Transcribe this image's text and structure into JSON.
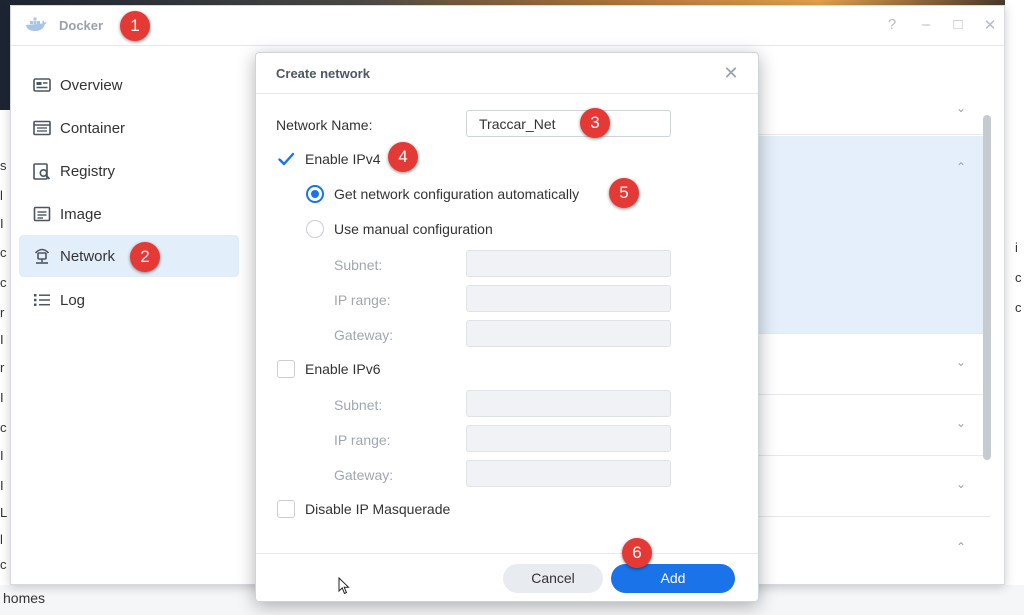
{
  "window": {
    "title": "Docker",
    "controls": {
      "help": "?",
      "minimize": "–",
      "maximize": "□",
      "close": "✕"
    }
  },
  "sidebar": {
    "items": [
      {
        "label": "Overview",
        "icon": "overview-icon"
      },
      {
        "label": "Container",
        "icon": "container-icon"
      },
      {
        "label": "Registry",
        "icon": "registry-icon"
      },
      {
        "label": "Image",
        "icon": "image-icon"
      },
      {
        "label": "Network",
        "icon": "network-icon",
        "active": true
      },
      {
        "label": "Log",
        "icon": "log-icon"
      }
    ]
  },
  "dialog": {
    "title": "Create network",
    "close": "✕",
    "network_name_label": "Network Name:",
    "network_name_value": "Traccar_Net",
    "enable_ipv4": {
      "label": "Enable IPv4",
      "checked": true
    },
    "auto_config": {
      "label": "Get network configuration automatically",
      "selected": true
    },
    "manual_config": {
      "label": "Use manual configuration",
      "selected": false
    },
    "ipv4_fields": {
      "subnet": "Subnet:",
      "ip_range": "IP range:",
      "gateway": "Gateway:"
    },
    "enable_ipv6": {
      "label": "Enable IPv6",
      "checked": false
    },
    "ipv6_fields": {
      "subnet": "Subnet:",
      "ip_range": "IP range:",
      "gateway": "Gateway:"
    },
    "disable_masquerade": {
      "label": "Disable IP Masquerade",
      "checked": false
    },
    "buttons": {
      "cancel": "Cancel",
      "add": "Add"
    }
  },
  "callouts": [
    "1",
    "2",
    "3",
    "4",
    "5",
    "6"
  ],
  "background_text": {
    "homes": "homes",
    "left_edge": [
      "s",
      "l",
      "I",
      "c",
      "c",
      "r",
      "I",
      "r",
      "I",
      "c",
      "I",
      "I",
      "L",
      "l",
      "c",
      "h"
    ],
    "right_edge": [
      "i",
      "c",
      "c"
    ]
  },
  "colors": {
    "accent": "#1a73e8",
    "callout": "#e53935",
    "active_nav_bg": "#e3eefb"
  }
}
